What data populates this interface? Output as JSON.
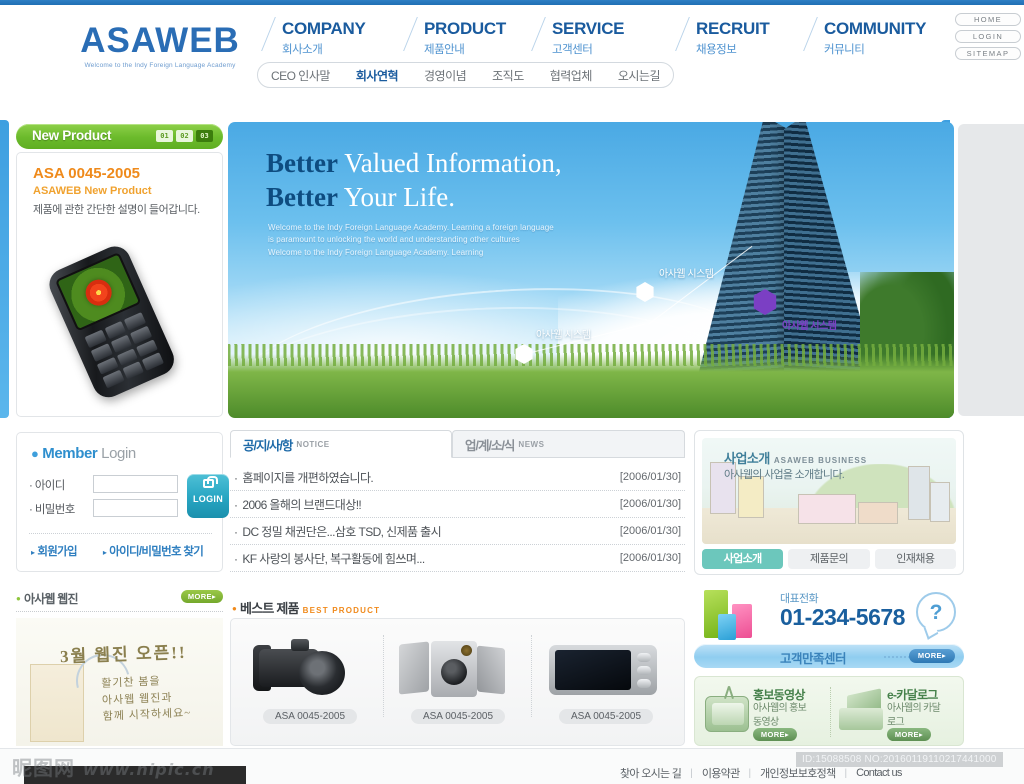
{
  "brand": {
    "logo": "ASAWEB",
    "tagline": "Welcome to the Indy Foreign Language Academy"
  },
  "header": {
    "nav": [
      {
        "en": "COMPANY",
        "ko": "회사소개"
      },
      {
        "en": "PRODUCT",
        "ko": "제품안내"
      },
      {
        "en": "SERVICE",
        "ko": "고객센터"
      },
      {
        "en": "RECRUIT",
        "ko": "채용정보"
      },
      {
        "en": "COMMUNITY",
        "ko": "커뮤니티"
      }
    ],
    "submenu": [
      {
        "label": "CEO 인사말",
        "active": false
      },
      {
        "label": "회사연혁",
        "active": true
      },
      {
        "label": "경영이념",
        "active": false
      },
      {
        "label": "조직도",
        "active": false
      },
      {
        "label": "협력업체",
        "active": false
      },
      {
        "label": "오시는길",
        "active": false
      }
    ],
    "utility": [
      "HOME",
      "LOGIN",
      "SITEMAP"
    ]
  },
  "new_product": {
    "header_title": "New Product",
    "pager": [
      "01",
      "02",
      "03"
    ],
    "active_page": "03",
    "title": "ASA 0045-2005",
    "subtitle": "ASAWEB New Product",
    "description": "제품에 관한 간단한 설명이 들어갑니다."
  },
  "banner": {
    "heading1_bold": "Better",
    "heading1_light": " Valued Information,",
    "heading2_bold": "Better",
    "heading2_light": " Your Life.",
    "paragraph": "Welcome to the Indy Foreign Language Academy. Learning a foreign language\nis paramount to unlocking the world and understanding other cultures\nWelcome to the Indy Foreign Language Academy. Learning",
    "nodes": [
      {
        "label": "아사웹 시스템",
        "style": "white-right"
      },
      {
        "label": "아사웹 시스템",
        "style": "white-left"
      },
      {
        "label": "아사웹 시스템",
        "style": "purple"
      }
    ]
  },
  "login": {
    "title_bold": "Member",
    "title_light": " Login",
    "id_label": "아이디",
    "pw_label": "비밀번호",
    "id_value": "",
    "pw_value": "",
    "id_placeholder": "",
    "pw_placeholder": "",
    "button_label": "LOGIN",
    "links": [
      "회원가입",
      "아이디/비밀번호 찾기"
    ]
  },
  "board": {
    "tabs": [
      {
        "ko": "공/지/사/항",
        "en": "NOTICE",
        "active": true
      },
      {
        "ko": "업/계/소/식",
        "en": "NEWS",
        "active": false
      }
    ],
    "rows": [
      {
        "title": "홈페이지를 개편하였습니다.",
        "date": "[2006/01/30]"
      },
      {
        "title": "2006 올해의 브랜드대상!!",
        "date": "[2006/01/30]"
      },
      {
        "title": "DC 정밀 채권단은...삼호 TSD, 신제품 출시",
        "date": "[2006/01/30]"
      },
      {
        "title": "KF 사랑의 봉사단, 복구활동에 힘쓰며...",
        "date": "[2006/01/30]"
      }
    ]
  },
  "business": {
    "title_ko": "사업소개",
    "title_en": "ASAWEB BUSINESS",
    "subtitle": "아사웹의 사업을 소개합니다.",
    "tabs": [
      {
        "label": "사업소개",
        "active": true
      },
      {
        "label": "제품문의",
        "active": false
      },
      {
        "label": "인재채용",
        "active": false
      }
    ]
  },
  "webzine": {
    "title": "아사웹 웹진",
    "more_label": "MORE▸",
    "headline": "3월 웹진 오픈!!",
    "body": "활기찬 봄을\n아사웹 웹진과\n함께 시작하세요~"
  },
  "best_product": {
    "title_ko": "베스트 제품",
    "title_en": "BEST PRODUCT",
    "items": [
      {
        "caption": "ASA 0045-2005",
        "icon": "camera-icon"
      },
      {
        "caption": "ASA 0045-2005",
        "icon": "speaker-icon"
      },
      {
        "caption": "ASA 0045-2005",
        "icon": "pmp-icon"
      }
    ]
  },
  "contact": {
    "tel_label": "대표전화",
    "tel_number": "01-234-5678",
    "cs_label": "고객만족센터",
    "cs_more": "MORE▸",
    "help_glyph": "?"
  },
  "promo": [
    {
      "title": "홍보동영상",
      "desc": "아사웹의 홍보\n동영상",
      "more": "MORE▸",
      "icon": "tv-icon"
    },
    {
      "title": "e-카달로그",
      "desc": "아사웹의 카달\n로그",
      "more": "MORE▸",
      "icon": "catalog-icon"
    }
  ],
  "footer": {
    "links": [
      "찾아 오시는 길",
      "이용약관",
      "개인정보보호정책",
      "Contact us"
    ],
    "separator": "|"
  },
  "watermark": {
    "brand": "昵图网",
    "url": "www.nipic.cn",
    "id_tag": "ID:15088508 NO:20160119110217441000"
  },
  "colors": {
    "brand_blue": "#2a6db5",
    "nav_blue": "#1a5b9e",
    "accent_orange": "#ef8a1b",
    "green": "#6cbb2c",
    "teal": "#27a5c2",
    "rail_blue": "#4aa9e4"
  }
}
